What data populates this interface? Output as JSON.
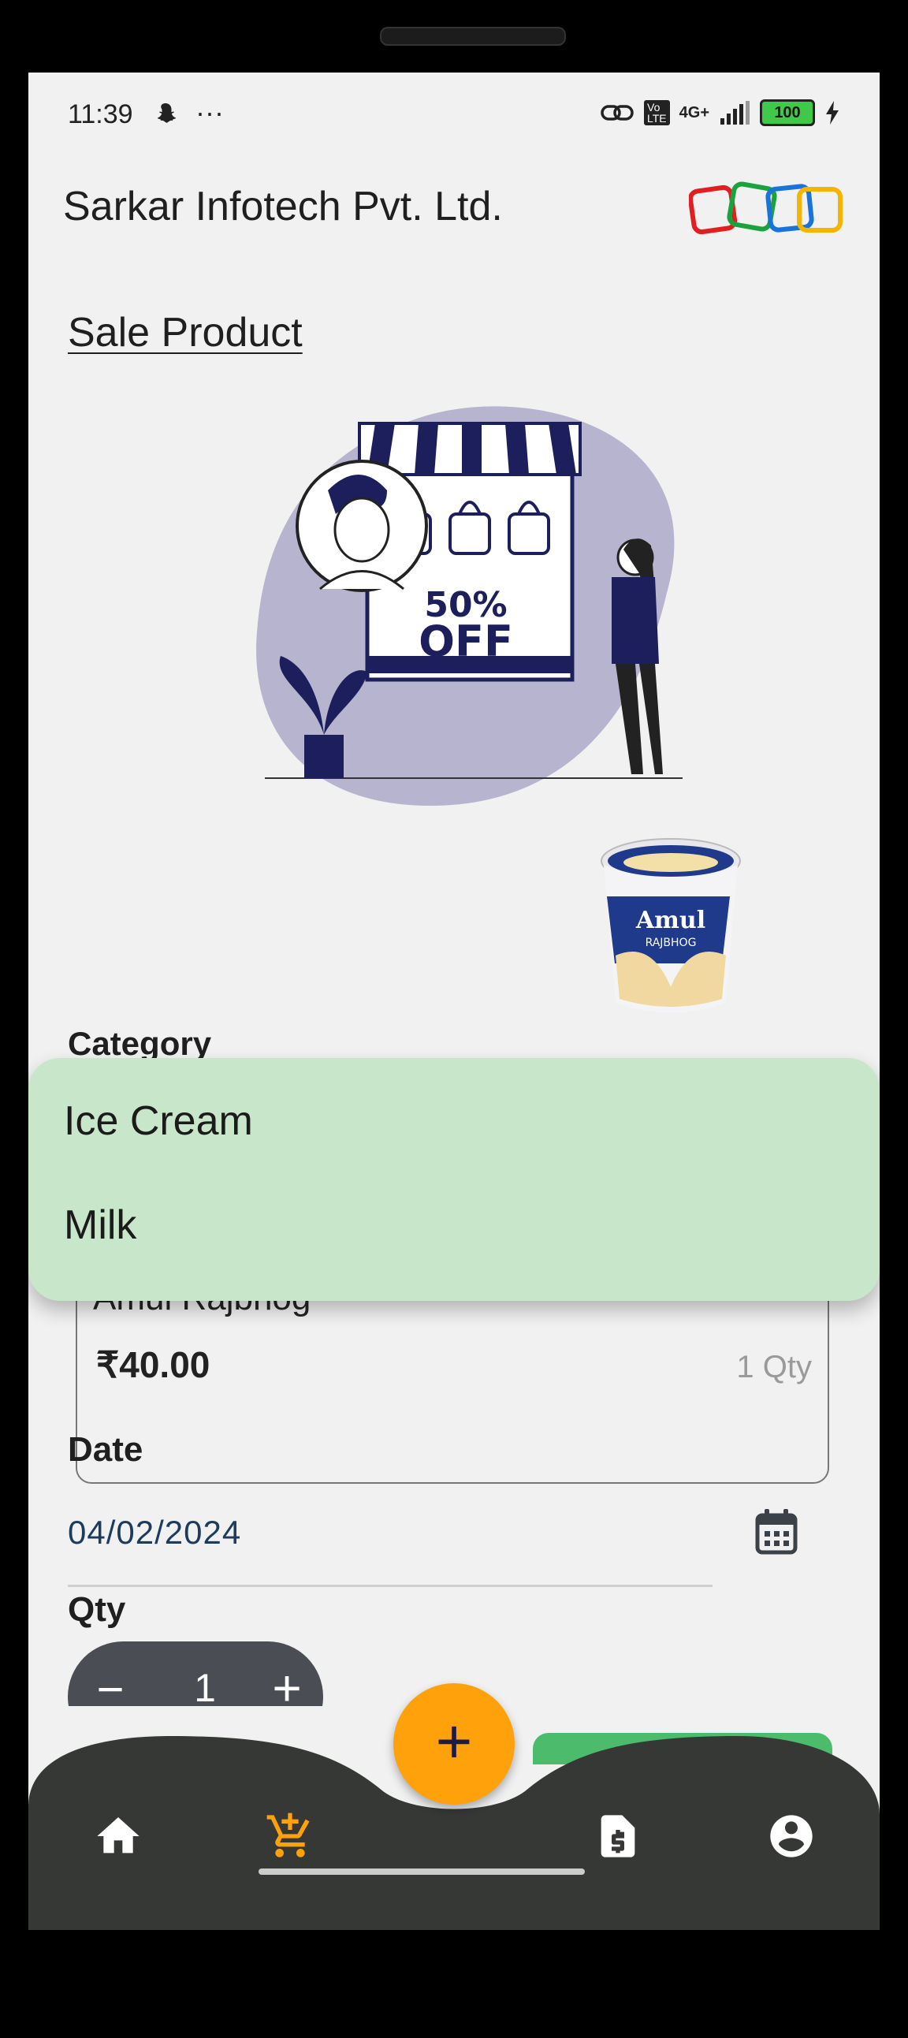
{
  "status_bar": {
    "time": "11:39",
    "more": "···",
    "network": "4G+",
    "volte": "VoLTE",
    "battery": "100"
  },
  "header": {
    "company_name": "Sarkar Infotech Pvt. Ltd."
  },
  "page": {
    "title": "Sale Product"
  },
  "illustration": {
    "sale_text_1": "50%",
    "sale_text_2": "OFF"
  },
  "product_image": {
    "brand": "Amul",
    "variant": "RAJBHOG"
  },
  "category": {
    "label": "Category"
  },
  "dropdown": {
    "options": [
      "Ice Cream",
      "Milk"
    ]
  },
  "product_card": {
    "name": "Amul Rajbhog",
    "price": "₹40.00",
    "qty": "1 Qty"
  },
  "date": {
    "label": "Date",
    "value": "04/02/2024"
  },
  "qty": {
    "label": "Qty",
    "value": "1",
    "minus": "−",
    "plus": "+"
  },
  "fab": {
    "symbol": "+"
  },
  "bottom_nav": {
    "items": [
      "home-icon",
      "cart-add-icon",
      "invoice-icon",
      "account-icon"
    ],
    "active_color": "#FFA10A",
    "inactive_color": "#FFFFFF",
    "bar_color": "#363835"
  }
}
